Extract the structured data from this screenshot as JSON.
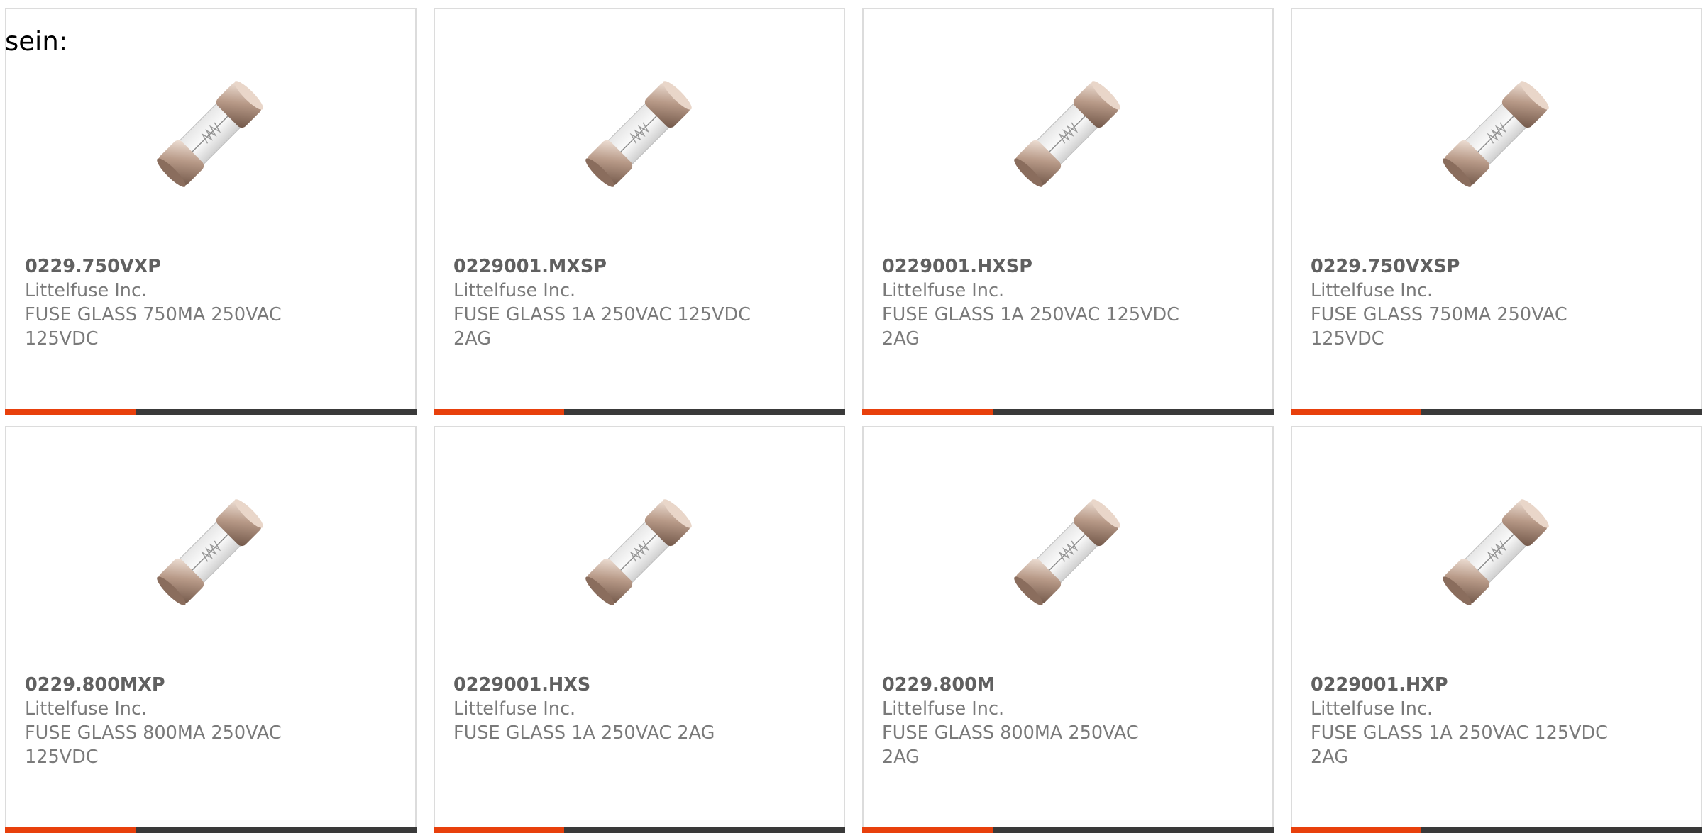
{
  "intro_text": "sein:",
  "accent_color": "#e8400c",
  "bar_color": "#3a3a3a",
  "products": [
    {
      "part": "0229.750VXP",
      "manufacturer": "Littelfuse Inc.",
      "description": "FUSE GLASS 750MA 250VAC 125VDC",
      "image": "glass-fuse-icon"
    },
    {
      "part": "0229001.MXSP",
      "manufacturer": "Littelfuse Inc.",
      "description": "FUSE GLASS 1A 250VAC 125VDC 2AG",
      "image": "glass-fuse-icon"
    },
    {
      "part": "0229001.HXSP",
      "manufacturer": "Littelfuse Inc.",
      "description": "FUSE GLASS 1A 250VAC 125VDC 2AG",
      "image": "glass-fuse-icon"
    },
    {
      "part": "0229.750VXSP",
      "manufacturer": "Littelfuse Inc.",
      "description": "FUSE GLASS 750MA 250VAC 125VDC",
      "image": "glass-fuse-icon"
    },
    {
      "part": "0229.800MXP",
      "manufacturer": "Littelfuse Inc.",
      "description": "FUSE GLASS 800MA 250VAC 125VDC",
      "image": "glass-fuse-icon"
    },
    {
      "part": "0229001.HXS",
      "manufacturer": "Littelfuse Inc.",
      "description": "FUSE GLASS 1A 250VAC 2AG",
      "image": "glass-fuse-icon"
    },
    {
      "part": "0229.800M",
      "manufacturer": "Littelfuse Inc.",
      "description": "FUSE GLASS 800MA 250VAC 2AG",
      "image": "glass-fuse-icon"
    },
    {
      "part": "0229001.HXP",
      "manufacturer": "Littelfuse Inc.",
      "description": "FUSE GLASS 1A 250VAC 125VDC 2AG",
      "image": "glass-fuse-icon"
    }
  ]
}
